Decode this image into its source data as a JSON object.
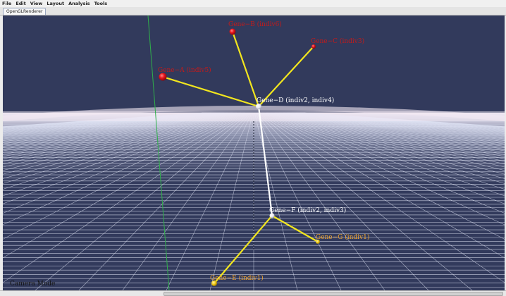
{
  "menubar": {
    "items": [
      {
        "id": "file",
        "label": "File"
      },
      {
        "id": "edit",
        "label": "Edit"
      },
      {
        "id": "view",
        "label": "View"
      },
      {
        "id": "layout",
        "label": "Layout"
      },
      {
        "id": "analysis",
        "label": "Analysis"
      },
      {
        "id": "tools",
        "label": "Tools"
      }
    ]
  },
  "tab": {
    "label": "OpenGLRenderer"
  },
  "viewport": {
    "background": "#323a5c",
    "camera_mode": "Camera Mode",
    "nodes": [
      {
        "id": "gene-a",
        "label": "Gene−A (indiv5)",
        "color": "#e8141c",
        "text_color": "#c41a1a"
      },
      {
        "id": "gene-b",
        "label": "Gene−B (indiv6)",
        "color": "#e8141c",
        "text_color": "#c41a1a"
      },
      {
        "id": "gene-c",
        "label": "Gene−C (indiv3)",
        "color": "#e8141c",
        "text_color": "#c41a1a"
      },
      {
        "id": "gene-d",
        "label": "Gene−D (indiv2, indiv4)",
        "color": "#ffffff",
        "text_color": "#ffffff"
      },
      {
        "id": "gene-e",
        "label": "Gene−E (indiv1)",
        "color": "#f2cd16",
        "text_color": "#f0a531"
      },
      {
        "id": "gene-f",
        "label": "Gene−F (indiv2, indiv3)",
        "color": "#ffffff",
        "text_color": "#ffffff"
      },
      {
        "id": "gene-g",
        "label": "Gene−G (indiv1)",
        "color": "#f2cd16",
        "text_color": "#f0a531"
      }
    ],
    "edges": [
      {
        "from": "gene-d",
        "to": "gene-a",
        "color": "#f2e61e"
      },
      {
        "from": "gene-d",
        "to": "gene-b",
        "color": "#f2e61e"
      },
      {
        "from": "gene-d",
        "to": "gene-c",
        "color": "#f2e61e"
      },
      {
        "from": "gene-d",
        "to": "gene-f",
        "color": "#ffffff"
      },
      {
        "from": "gene-f",
        "to": "gene-e",
        "color": "#f2e61e"
      },
      {
        "from": "gene-f",
        "to": "gene-g",
        "color": "#f2e61e"
      }
    ],
    "colors": {
      "grid_line": "#dfe4f5",
      "horizon_glow": "#f3eaf4",
      "y_axis": "#2fb04a",
      "z_axis": "#1a1f30"
    }
  }
}
